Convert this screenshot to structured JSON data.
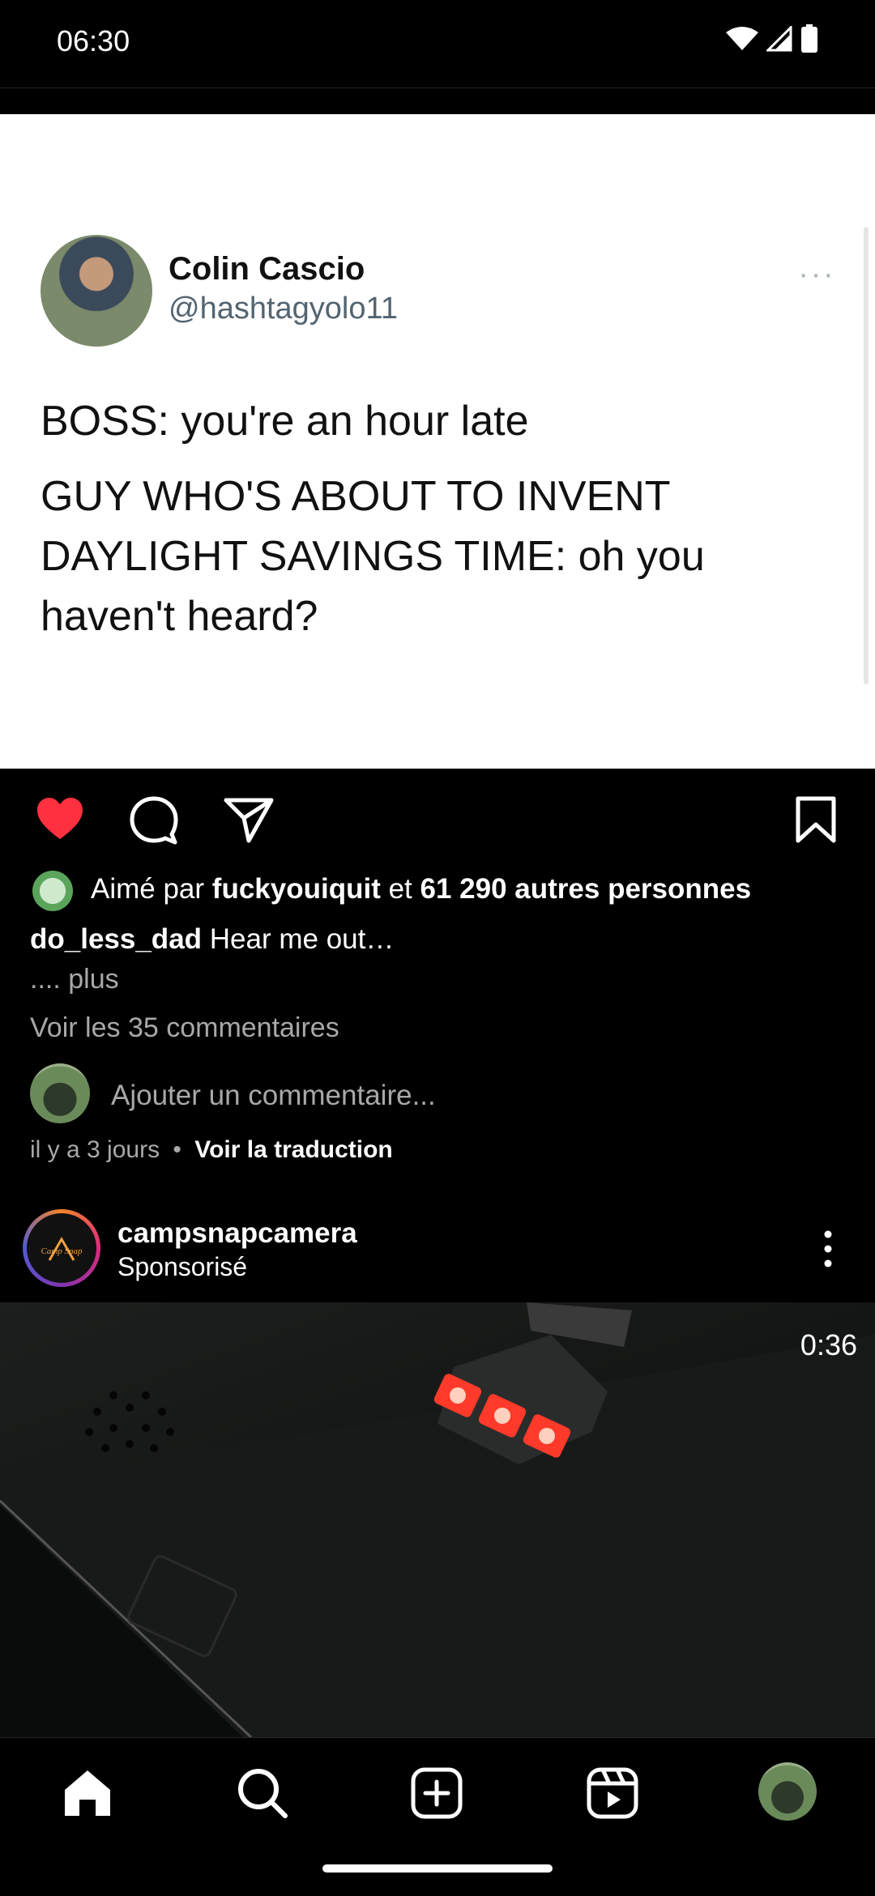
{
  "status_bar": {
    "time": "06:30"
  },
  "tweet": {
    "name": "Colin Cascio",
    "handle": "@hashtagyolo11",
    "more": "···",
    "line1": "BOSS: you're an hour late",
    "line2": "GUY WHO'S ABOUT TO INVENT",
    "line3": "DAYLIGHT SAVINGS TIME: oh you",
    "line4": "haven't heard?"
  },
  "post": {
    "liked": true,
    "likes_prefix": "Aimé par",
    "liker": "fuckyouiquit",
    "likes_conj": "et",
    "likes_rest": "61 290 autres personnes",
    "caption_user": "do_less_dad",
    "caption_text": "Hear me out…",
    "more_label": ".... plus",
    "view_comments": "Voir les 35 commentaires",
    "add_comment_placeholder": "Ajouter un commentaire...",
    "time_ago": "il y a 3 jours",
    "separator": "•",
    "see_translation": "Voir la traduction"
  },
  "ad": {
    "username": "campsnapcamera",
    "sponsored": "Sponsorisé",
    "logo_text": "Camp Snap",
    "video_time": "0:36"
  },
  "icons": {
    "like": "heart-icon",
    "comment": "comment-icon",
    "share": "paper-plane-icon",
    "save": "bookmark-icon",
    "home": "home-icon",
    "search": "search-icon",
    "create": "plus-square-icon",
    "reels": "reels-icon"
  },
  "colors": {
    "like": "#ff3040",
    "muted_text": "#a8a8a8"
  }
}
